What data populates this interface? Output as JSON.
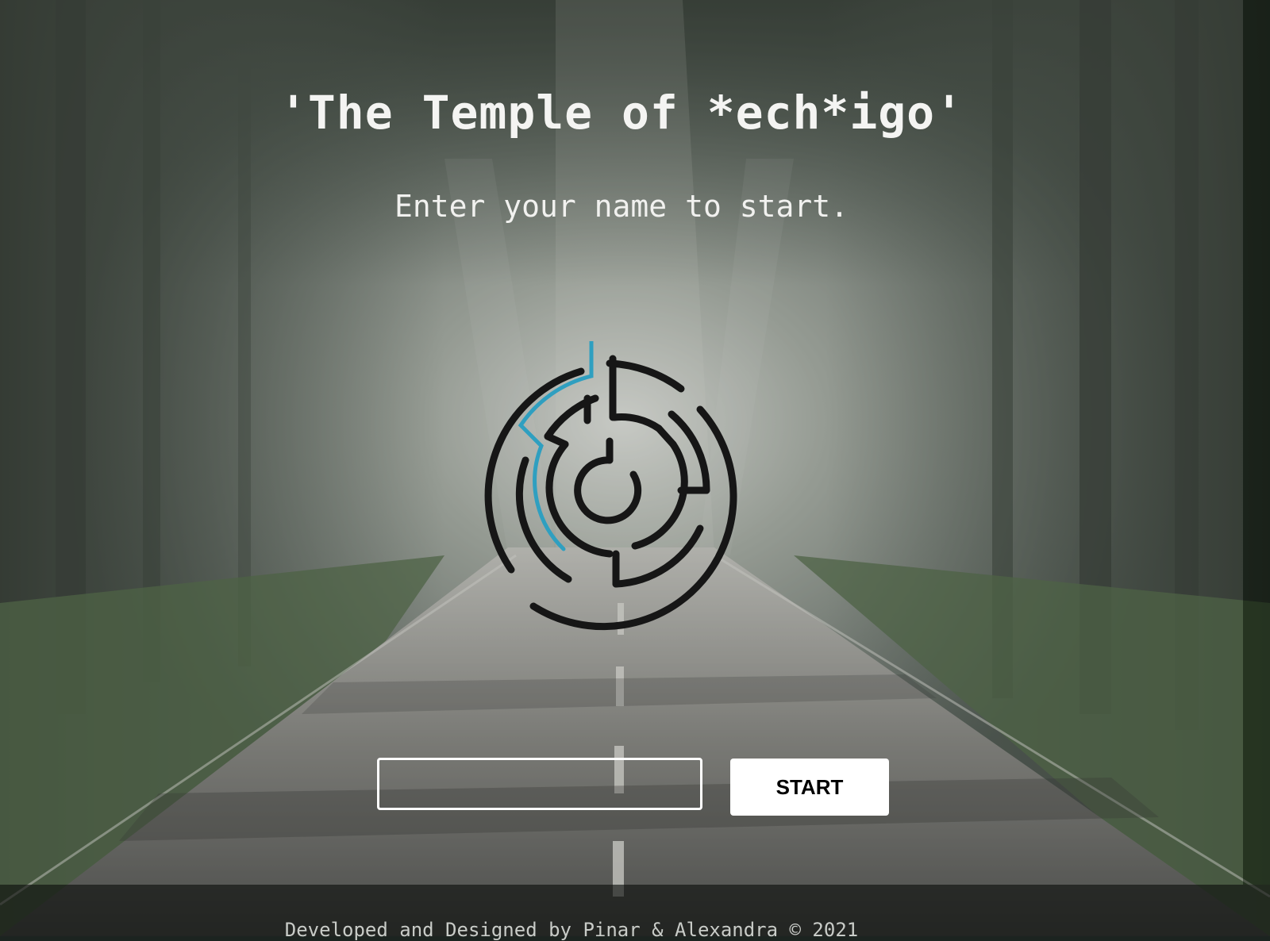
{
  "page": {
    "title": "'The Temple of *ech*igo'",
    "subtitle": "Enter your name to start."
  },
  "form": {
    "name_input_value": "",
    "name_input_placeholder": "",
    "start_label": "START"
  },
  "footer": {
    "credit": "Developed and Designed by Pinar & Alexandra © 2021"
  },
  "icons": {
    "logo": "maze-icon"
  },
  "colors": {
    "maze_stroke": "#161616",
    "maze_path": "#2f9fc0",
    "button_bg": "#ffffff",
    "text": "#f4f4f2"
  }
}
